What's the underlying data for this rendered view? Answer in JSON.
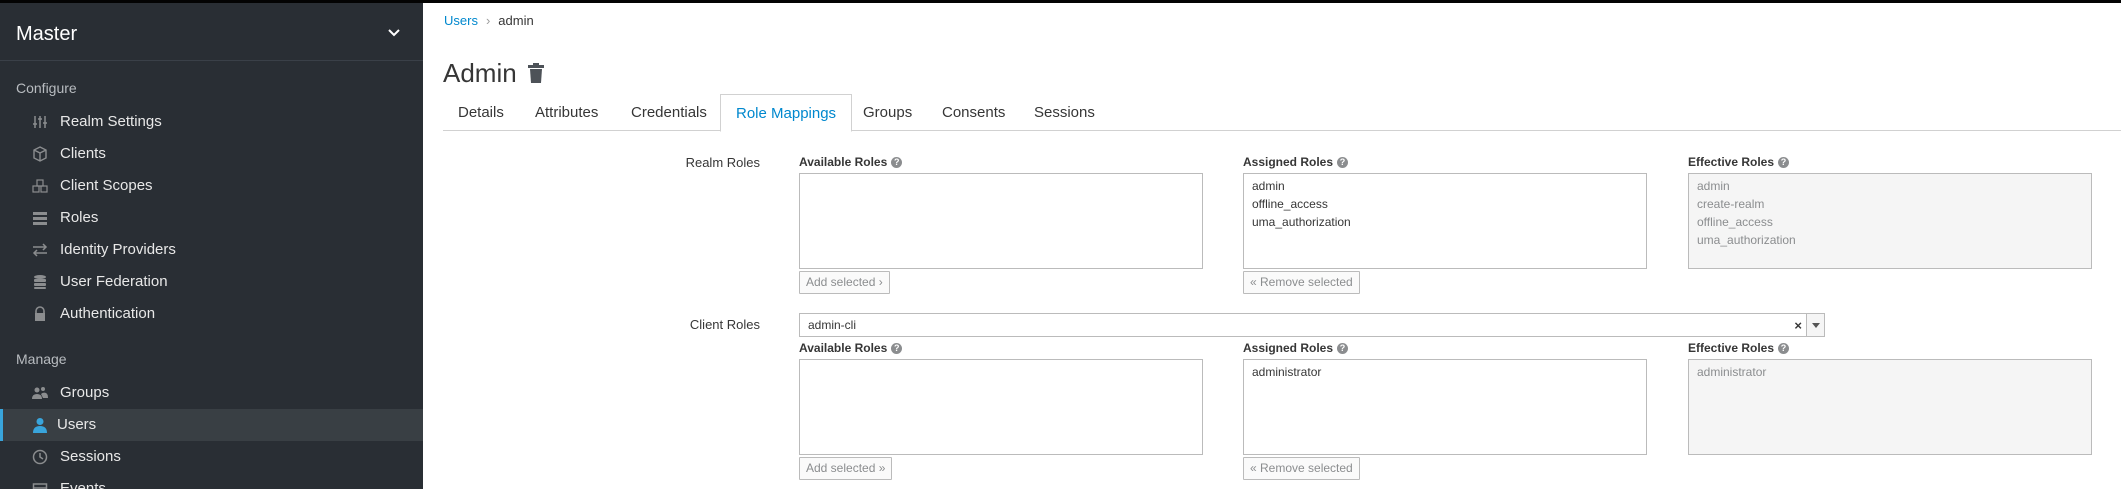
{
  "sidebar": {
    "realm": "Master",
    "configure_label": "Configure",
    "configure_items": [
      {
        "label": "Realm Settings",
        "icon": "sliders-icon"
      },
      {
        "label": "Clients",
        "icon": "cube-icon"
      },
      {
        "label": "Client Scopes",
        "icon": "cubes-icon"
      },
      {
        "label": "Roles",
        "icon": "list-icon"
      },
      {
        "label": "Identity Providers",
        "icon": "exchange-icon"
      },
      {
        "label": "User Federation",
        "icon": "database-icon"
      },
      {
        "label": "Authentication",
        "icon": "lock-icon"
      }
    ],
    "manage_label": "Manage",
    "manage_items": [
      {
        "label": "Groups",
        "icon": "users-icon"
      },
      {
        "label": "Users",
        "icon": "user-icon",
        "active": true
      },
      {
        "label": "Sessions",
        "icon": "clock-icon"
      },
      {
        "label": "Events",
        "icon": "calendar-icon"
      }
    ]
  },
  "breadcrumb": {
    "root": "Users",
    "separator": "›",
    "current": "admin"
  },
  "page_title": "Admin",
  "tabs": [
    "Details",
    "Attributes",
    "Credentials",
    "Role Mappings",
    "Groups",
    "Consents",
    "Sessions"
  ],
  "active_tab": "Role Mappings",
  "realm_roles": {
    "label": "Realm Roles",
    "available_label": "Available Roles",
    "assigned_label": "Assigned Roles",
    "effective_label": "Effective Roles",
    "available": [],
    "assigned": [
      "admin",
      "offline_access",
      "uma_authorization"
    ],
    "effective": [
      "admin",
      "create-realm",
      "offline_access",
      "uma_authorization"
    ],
    "add_button": "Add selected ›",
    "remove_button": "« Remove selected"
  },
  "client_roles": {
    "label": "Client Roles",
    "selected_client": "admin-cli",
    "clear_symbol": "×",
    "available_label": "Available Roles",
    "assigned_label": "Assigned Roles",
    "effective_label": "Effective Roles",
    "available": [],
    "assigned": [
      "administrator"
    ],
    "effective": [
      "administrator"
    ],
    "add_button": "Add selected »",
    "remove_button": "« Remove selected"
  },
  "colors": {
    "sidebar_bg": "#292e34",
    "accent": "#0088ce",
    "active_border": "#39a5dc"
  }
}
